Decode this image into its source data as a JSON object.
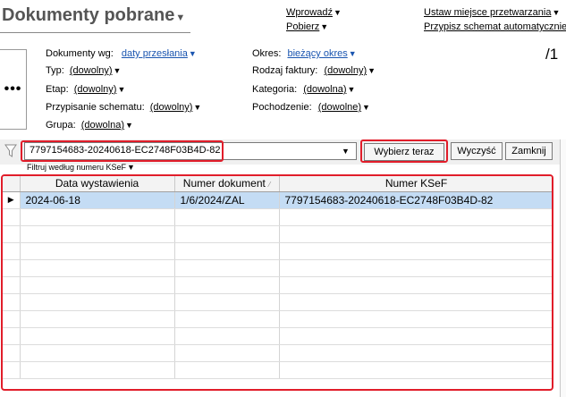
{
  "header": {
    "title": "Dokumenty pobrane",
    "menu": {
      "wprowadz": "Wprowadź",
      "pobierz": "Pobierz",
      "ustaw_miejsce": "Ustaw miejsce przetwarzania",
      "przypisz_schemat": "Przypisz schemat automatycznie"
    },
    "page_indicator": "/1"
  },
  "filters": {
    "more_button": "•••",
    "dokumenty_wg": {
      "label": "Dokumenty wg:",
      "value": "daty przesłania"
    },
    "typ": {
      "label": "Typ:",
      "value": "(dowolny)"
    },
    "etap": {
      "label": "Etap:",
      "value": "(dowolny)"
    },
    "przypisanie": {
      "label": "Przypisanie schematu:",
      "value": "(dowolny)"
    },
    "grupa": {
      "label": "Grupa:",
      "value": "(dowolna)"
    },
    "okres": {
      "label": "Okres:",
      "value": "bieżący okres"
    },
    "rodzaj": {
      "label": "Rodzaj faktury:",
      "value": "(dowolny)"
    },
    "kategoria": {
      "label": "Kategoria:",
      "value": "(dowolna)"
    },
    "pochodzenie": {
      "label": "Pochodzenie:",
      "value": "(dowolne)"
    }
  },
  "search": {
    "value": "7797154683-20240618-EC2748F03B4D-82",
    "hint": "Filtruj według numeru KSeF",
    "buttons": {
      "wybierz": "Wybierz teraz",
      "wyczysc": "Wyczyść",
      "zamknij": "Zamknij"
    }
  },
  "grid": {
    "columns": [
      "Data wystawienia",
      "Numer dokument",
      "Numer KSeF"
    ],
    "rows": [
      {
        "data": "2024-06-18",
        "numer": "1/6/2024/ZAL",
        "ksef": "7797154683-20240618-EC2748F03B4D-82"
      }
    ]
  },
  "colors": {
    "accent_red": "#e11d2a",
    "selected_row": "#c4dcf4",
    "link_blue": "#1a55b0"
  },
  "icons": [
    "chevron-down-icon",
    "more-icon",
    "filter-icon",
    "row-pointer-icon",
    "sort-icon"
  ]
}
